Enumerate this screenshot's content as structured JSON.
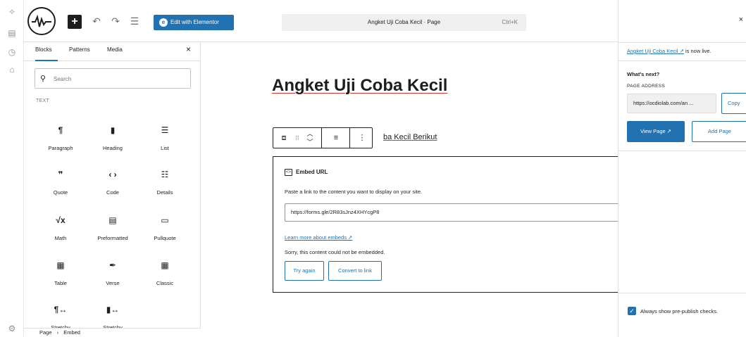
{
  "admin_strip": {
    "icons": [
      "sparkle-icon",
      "pages-icon",
      "history-icon",
      "home-icon",
      "settings-icon"
    ]
  },
  "topbar": {
    "logo": "waveform-logo",
    "add_block": "+",
    "undo": "↶",
    "redo": "↷",
    "list_view": "☰",
    "elementor_button": "Edit with Elementor",
    "command_title": "Angket Uji Coba Kecil · Page",
    "command_shortcut": "Ctrl+K"
  },
  "inserter": {
    "tabs": [
      "Blocks",
      "Patterns",
      "Media"
    ],
    "close": "×",
    "search_placeholder": "Search",
    "section": "TEXT",
    "blocks": [
      {
        "label": "Paragraph",
        "glyph": "¶"
      },
      {
        "label": "Heading",
        "glyph": "▮"
      },
      {
        "label": "List",
        "glyph": "☰"
      },
      {
        "label": "Quote",
        "glyph": "❞"
      },
      {
        "label": "Code",
        "glyph": "‹ ›"
      },
      {
        "label": "Details",
        "glyph": "☷"
      },
      {
        "label": "Math",
        "glyph": "√x"
      },
      {
        "label": "Preformatted",
        "glyph": "▤"
      },
      {
        "label": "Pullquote",
        "glyph": "▭"
      },
      {
        "label": "Table",
        "glyph": "▦"
      },
      {
        "label": "Verse",
        "glyph": "✒"
      },
      {
        "label": "Classic",
        "glyph": "▦"
      },
      {
        "label": "Stretchy",
        "glyph": "¶↔"
      },
      {
        "label": "Stretchy",
        "glyph": "▮↔"
      }
    ]
  },
  "breadcrumb": {
    "page": "Page",
    "sep": "›",
    "current": "Embed"
  },
  "canvas": {
    "title": "Angket Uji Coba Kecil",
    "para_visible": "ba Kecil Berikut",
    "embed": {
      "heading": "Embed URL",
      "instructions": "Paste a link to the content you want to display on your site.",
      "url_value": "https://forms.gle/2R83sJnz4XHYcgP8",
      "learn_link": "Learn more about embeds ↗",
      "error": "Sorry, this content could not be embedded.",
      "try_again": "Try again",
      "convert": "Convert to link"
    }
  },
  "right_panel": {
    "close": "×",
    "live_link": "Angket Uji Coba Kecil ↗",
    "live_suffix": " is now live.",
    "whats_next": "What's next?",
    "address_label": "PAGE ADDRESS",
    "address_value": "https://ocdiolab.com/an ...",
    "copy": "Copy",
    "view_page": "View Page ↗",
    "add_page": "Add Page",
    "always_show": "Always show pre-publish checks."
  }
}
